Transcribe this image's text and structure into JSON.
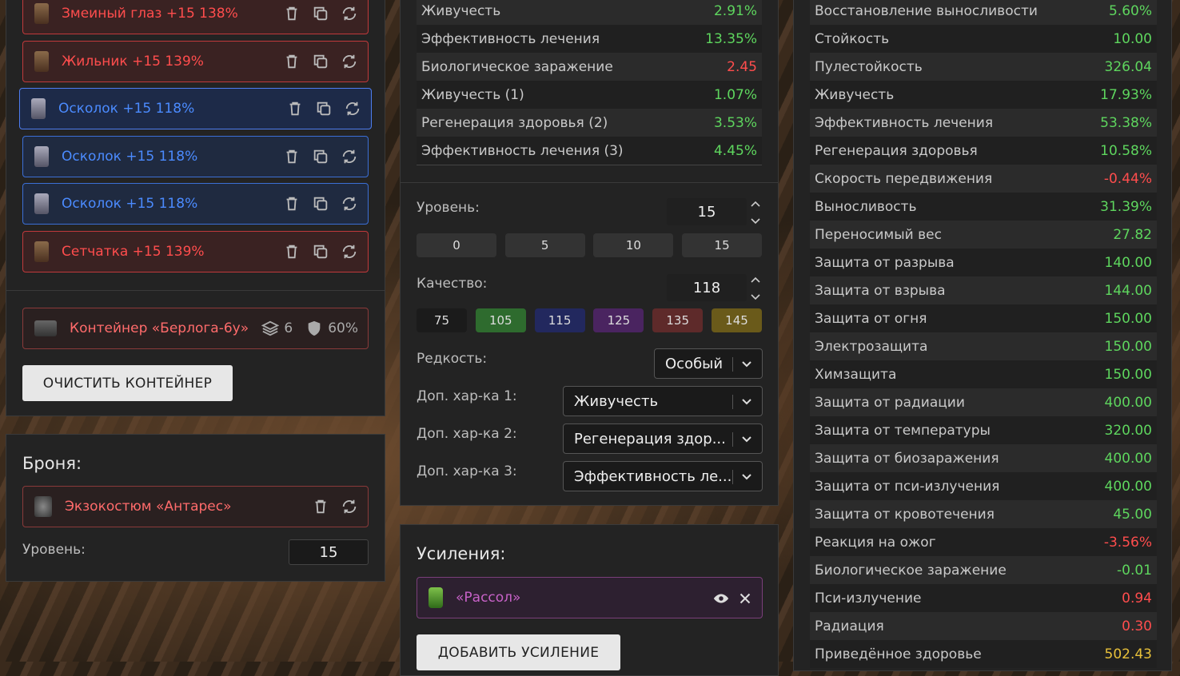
{
  "artifacts": [
    {
      "name": "Змеиный глаз +15 138%",
      "type": "red",
      "copy": true
    },
    {
      "name": "Жильник +15 139%",
      "type": "red",
      "copy": true
    },
    {
      "name": "Осколок +15 118%",
      "type": "blue",
      "copy": true
    },
    {
      "name": "Осколок +15 118%",
      "type": "blue",
      "copy": true
    },
    {
      "name": "Осколок +15 118%",
      "type": "blue",
      "copy": true
    },
    {
      "name": "Сетчатка +15 139%",
      "type": "red",
      "copy": true
    }
  ],
  "container": {
    "name": "Контейнер «Берлога-6у»",
    "slots": "6",
    "protection": "60%",
    "clear_label": "ОЧИСТИТЬ КОНТЕЙНЕР"
  },
  "armor": {
    "title": "Броня:",
    "item": "Экзокостюм «Антарес»",
    "level_label": "Уровень:",
    "level_value": "15"
  },
  "artifact_stats": [
    {
      "label": "Живучесть",
      "value": "2.91%",
      "color": "g"
    },
    {
      "label": "Эффективность лечения",
      "value": "13.35%",
      "color": "g"
    },
    {
      "label": "Биологическое заражение",
      "value": "2.45",
      "color": "rr"
    },
    {
      "label": "Живучесть (1)",
      "value": "1.07%",
      "color": "g"
    },
    {
      "label": "Регенерация здоровья (2)",
      "value": "3.53%",
      "color": "g"
    },
    {
      "label": "Эффективность лечения (3)",
      "value": "4.45%",
      "color": "g"
    }
  ],
  "editor": {
    "level_label": "Уровень:",
    "level_value": "15",
    "level_presets": [
      "0",
      "5",
      "10",
      "15"
    ],
    "quality_label": "Качество:",
    "quality_value": "118",
    "quality_presets": [
      {
        "v": "75",
        "bg": "#1b1b1b"
      },
      {
        "v": "105",
        "bg": "#2e6b2e"
      },
      {
        "v": "115",
        "bg": "#22285e"
      },
      {
        "v": "125",
        "bg": "#4a2460"
      },
      {
        "v": "135",
        "bg": "#5e2a2a"
      },
      {
        "v": "145",
        "bg": "#6a5a1a"
      }
    ],
    "rarity_label": "Редкость:",
    "rarity_value": "Особый",
    "extra1_label": "Доп. хар-ка 1:",
    "extra1_value": "Живучесть",
    "extra2_label": "Доп. хар-ка 2:",
    "extra2_value": "Регенерация здор...",
    "extra3_label": "Доп. хар-ка 3:",
    "extra3_value": "Эффективность ле..."
  },
  "boosts": {
    "title": "Усиления:",
    "item": "«Рассол»",
    "add_label": "ДОБАВИТЬ УСИЛЕНИЕ"
  },
  "total_stats": [
    {
      "label": "Восстановление выносливости",
      "value": "5.60%",
      "color": "g"
    },
    {
      "label": "Стойкость",
      "value": "10.00",
      "color": "g"
    },
    {
      "label": "Пулестойкость",
      "value": "326.04",
      "color": "g"
    },
    {
      "label": "Живучесть",
      "value": "17.93%",
      "color": "g"
    },
    {
      "label": "Эффективность лечения",
      "value": "53.38%",
      "color": "g"
    },
    {
      "label": "Регенерация здоровья",
      "value": "10.58%",
      "color": "g"
    },
    {
      "label": "Скорость передвижения",
      "value": "-0.44%",
      "color": "rr"
    },
    {
      "label": "Выносливость",
      "value": "31.39%",
      "color": "g"
    },
    {
      "label": "Переносимый вес",
      "value": "27.82",
      "color": "g"
    },
    {
      "label": "Защита от разрыва",
      "value": "140.00",
      "color": "g"
    },
    {
      "label": "Защита от взрыва",
      "value": "144.00",
      "color": "g"
    },
    {
      "label": "Защита от огня",
      "value": "150.00",
      "color": "g"
    },
    {
      "label": "Электрозащита",
      "value": "150.00",
      "color": "g"
    },
    {
      "label": "Химзащита",
      "value": "150.00",
      "color": "g"
    },
    {
      "label": "Защита от радиации",
      "value": "400.00",
      "color": "g"
    },
    {
      "label": "Защита от температуры",
      "value": "320.00",
      "color": "g"
    },
    {
      "label": "Защита от биозаражения",
      "value": "400.00",
      "color": "g"
    },
    {
      "label": "Защита от пси-излучения",
      "value": "400.00",
      "color": "g"
    },
    {
      "label": "Защита от кровотечения",
      "value": "45.00",
      "color": "g"
    },
    {
      "label": "Реакция на ожог",
      "value": "-3.56%",
      "color": "rr"
    },
    {
      "label": "Биологическое заражение",
      "value": "-0.01",
      "color": "g"
    },
    {
      "label": "Пси-излучение",
      "value": "0.94",
      "color": "rr"
    },
    {
      "label": "Радиация",
      "value": "0.30",
      "color": "rr"
    },
    {
      "label": "Приведённое здоровье",
      "value": "502.43",
      "color": "y"
    }
  ]
}
